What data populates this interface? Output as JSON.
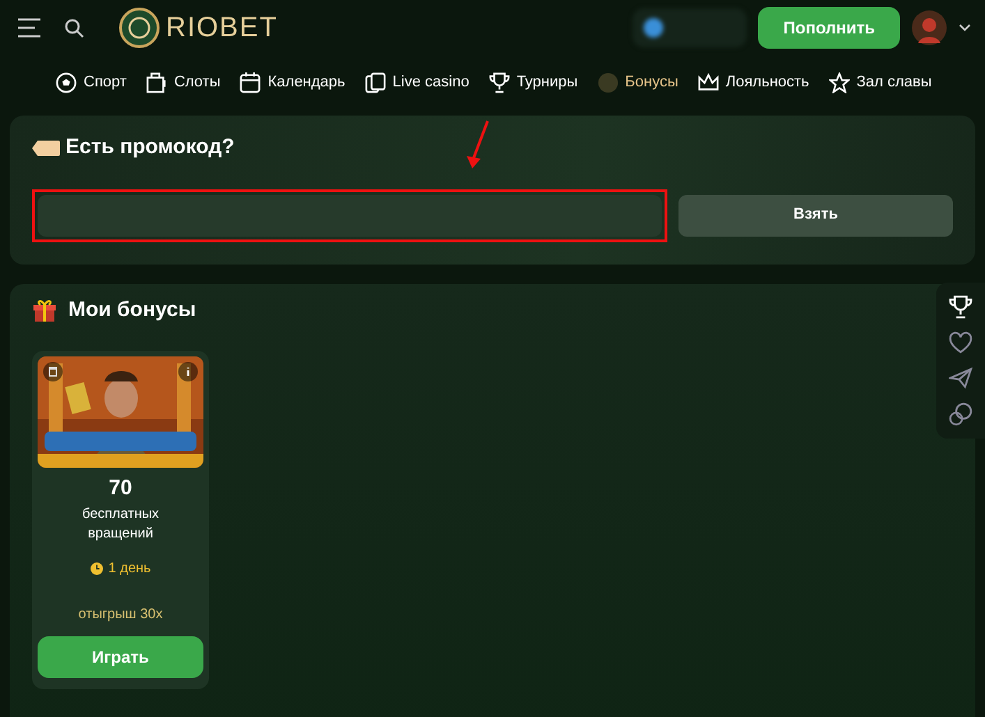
{
  "header": {
    "logo": "RIOBET",
    "deposit_button": "Пополнить"
  },
  "nav": [
    {
      "label": "Спорт",
      "kind": "ball",
      "selected": false
    },
    {
      "label": "Слоты",
      "kind": "slot",
      "selected": false
    },
    {
      "label": "Календарь",
      "kind": "calendar",
      "selected": false
    },
    {
      "label": "Live casino",
      "kind": "cards",
      "selected": false
    },
    {
      "label": "Турниры",
      "kind": "trophy",
      "selected": false
    },
    {
      "label": "Бонусы",
      "kind": "coin",
      "selected": true
    },
    {
      "label": "Лояльность",
      "kind": "crown",
      "selected": false
    },
    {
      "label": "Зал славы",
      "kind": "star",
      "selected": false
    }
  ],
  "promo": {
    "title": "Есть промокод?",
    "highlighted": true,
    "button": "Взять"
  },
  "bonuses": {
    "title": "Мои бонусы",
    "cards": [
      {
        "kind": "picture",
        "amount": "70",
        "description": "бесплатных вращений",
        "time": "1 день",
        "wager": "отыгрыш 30x",
        "button": "Играть"
      }
    ]
  },
  "side_tools": [
    {
      "kind": "trophy"
    },
    {
      "kind": "heart"
    },
    {
      "kind": "send"
    },
    {
      "kind": "chat"
    }
  ]
}
